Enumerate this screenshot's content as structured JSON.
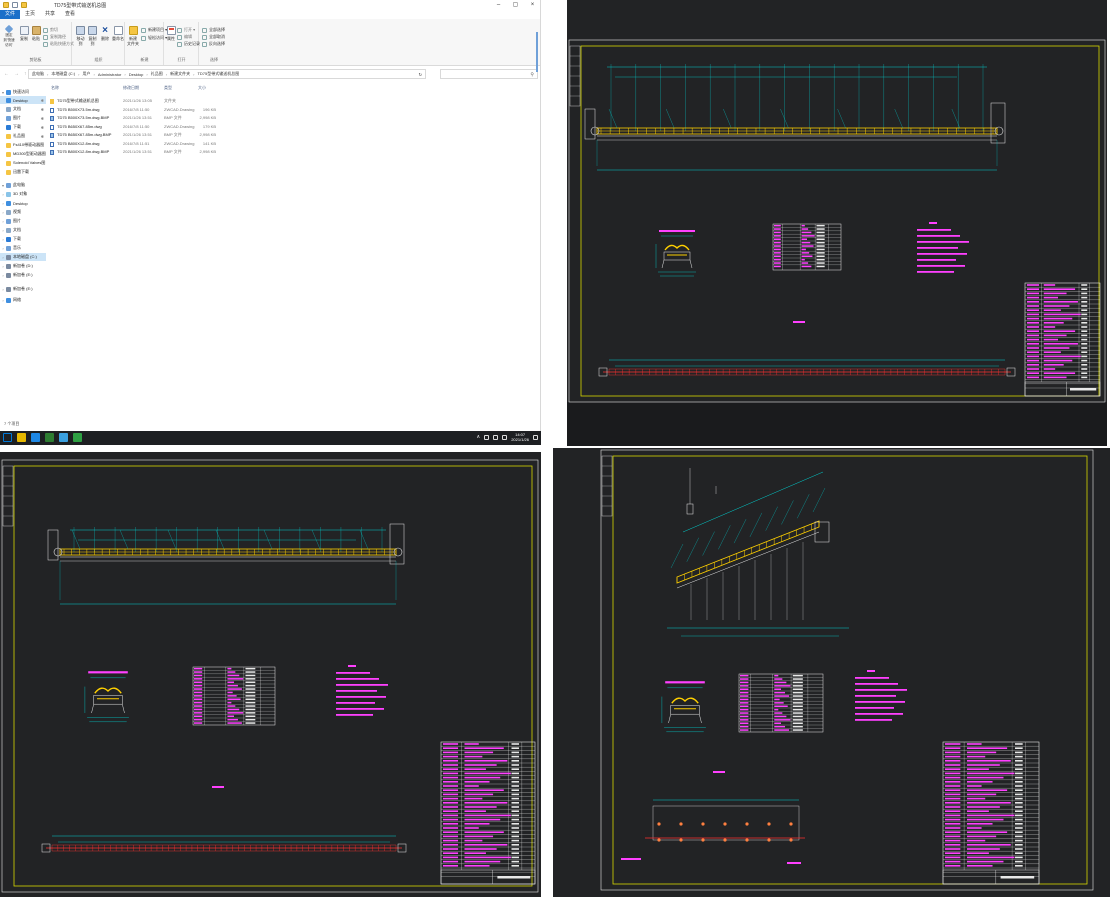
{
  "window": {
    "title": "TD75型带式输送机总图",
    "controls": {
      "minimize": "–",
      "maximize": "▢",
      "close": "×"
    }
  },
  "ribbon": {
    "tabs": [
      "文件",
      "主页",
      "共享",
      "查看"
    ],
    "clipboard": {
      "pin": "固定到'快速访问'",
      "copy": "复制",
      "paste": "粘贴",
      "cut": "剪切",
      "copy_path": "复制路径",
      "paste_shortcut": "粘贴快捷方式",
      "label": "剪贴板"
    },
    "organize": {
      "move_to": "移动到",
      "copy_to": "复制到",
      "delete": "删除",
      "rename": "重命名",
      "label": "组织"
    },
    "new": {
      "new_folder": "新建\n文件夹",
      "new_item": "新建项目 ▾",
      "easy_access": "轻松访问 ▾",
      "label": "新建"
    },
    "open": {
      "properties": "属性",
      "open": "打开 ▾",
      "edit": "编辑",
      "history": "历史记录",
      "label": "打开"
    },
    "select": {
      "select_all": "全部选择",
      "select_none": "全部取消",
      "invert": "反向选择",
      "label": "选择"
    }
  },
  "address": {
    "back": "←",
    "forward": "→",
    "up": "↑",
    "path": [
      "此电脑",
      "本地磁盘 (C:)",
      "用户",
      "Administrator",
      "Desktop",
      "礼品图",
      "新建文件夹",
      "TD75型带式输送机总图"
    ],
    "refresh": "↻",
    "search_icon": "⚲"
  },
  "nav": [
    {
      "label": "快速访问",
      "chev": "▾",
      "icon": "#3f8fe0"
    },
    {
      "label": "Desktop",
      "chev": "",
      "icon": "#3f8fe0",
      "selected": true,
      "pin": "✱"
    },
    {
      "label": "文档",
      "chev": "",
      "icon": "#8aa8c8",
      "pin": "✱"
    },
    {
      "label": "图片",
      "chev": "",
      "icon": "#6fa0d8",
      "pin": "✱"
    },
    {
      "label": "下载",
      "chev": "",
      "icon": "#2a7bd6",
      "pin": "✱"
    },
    {
      "label": "礼品图",
      "chev": "",
      "icon": "#f5c542",
      "pin": "✱"
    },
    {
      "label": "Fs410带驱动器图",
      "chev": "",
      "icon": "#f5c542"
    },
    {
      "label": "MD300型驱动器图",
      "chev": "",
      "icon": "#f5c542"
    },
    {
      "label": "Solenoid Valves图",
      "chev": "",
      "icon": "#f5c542"
    },
    {
      "label": "迅雷下载",
      "chev": "",
      "icon": "#f5c542"
    },
    {
      "label": "此电脑",
      "chev": "▾",
      "icon": "#6fa0d8"
    },
    {
      "label": "3D 对象",
      "chev": "›",
      "icon": "#8ac4e8"
    },
    {
      "label": "Desktop",
      "chev": "›",
      "icon": "#3f8fe0"
    },
    {
      "label": "视频",
      "chev": "›",
      "icon": "#8aa8c8"
    },
    {
      "label": "图片",
      "chev": "›",
      "icon": "#6fa0d8"
    },
    {
      "label": "文档",
      "chev": "›",
      "icon": "#8aa8c8"
    },
    {
      "label": "下载",
      "chev": "›",
      "icon": "#2a7bd6"
    },
    {
      "label": "音乐",
      "chev": "›",
      "icon": "#6fa0d8"
    },
    {
      "label": "本地磁盘 (C:)",
      "chev": "›",
      "icon": "#7a8aa0",
      "selected": true
    },
    {
      "label": "新加卷 (D:)",
      "chev": "›",
      "icon": "#7a8aa0"
    },
    {
      "label": "新加卷 (E:)",
      "chev": "›",
      "icon": "#7a8aa0"
    },
    {
      "label": "新加卷 (E:)",
      "chev": "›",
      "icon": "#7a8aa0"
    },
    {
      "label": "网络",
      "chev": "›",
      "icon": "#3f8fe0"
    }
  ],
  "file_columns": [
    "名称",
    "修改日期",
    "类型",
    "大小"
  ],
  "files": [
    {
      "icon": "folder",
      "name": "TD75型带式输送机总图",
      "date": "2021/1/26 13:05",
      "type": "文件夹",
      "size": ""
    },
    {
      "icon": "dwg",
      "name": "TD75 B500X73.5m.dwg",
      "date": "2016/7/8 11:50",
      "type": "ZWCAD.Drawing",
      "size": "196 KB"
    },
    {
      "icon": "bmp",
      "name": "TD75 B500X73.5m.dwg.BMP",
      "date": "2021/1/26 13:51",
      "type": "BMP 文件",
      "size": "2,998 KB"
    },
    {
      "icon": "dwg",
      "name": "TD75 B650X67.85m.dwg",
      "date": "2016/7/8 11:50",
      "type": "ZWCAD.Drawing",
      "size": "179 KB"
    },
    {
      "icon": "bmp",
      "name": "TD75 B650X67.85m.dwg.BMP",
      "date": "2021/1/26 13:51",
      "type": "BMP 文件",
      "size": "2,998 KB"
    },
    {
      "icon": "dwg",
      "name": "TD75 B800X12.8m.dwg",
      "date": "2016/7/8 11:51",
      "type": "ZWCAD.Drawing",
      "size": "141 KB"
    },
    {
      "icon": "bmp",
      "name": "TD75 B800X12.8m.dwg.BMP",
      "date": "2021/1/26 13:51",
      "type": "BMP 文件",
      "size": "2,998 KB"
    }
  ],
  "status": {
    "count": "7 个项目"
  },
  "taskbar": {
    "up_arrow": "∧",
    "time": "14:07",
    "date": "2021/1/26",
    "icons": [
      "#0078d7",
      "#e6b800",
      "#1e88e5",
      "#2e7d32",
      "#3aa0e0",
      "#2ea043"
    ]
  },
  "cad": {
    "colors": {
      "frame": "#d8d800",
      "dim": "#00d0d0",
      "text": "#ff40ff",
      "belt": "#ffd000",
      "center": "#ff3030",
      "white": "#e8e8e8"
    },
    "panels": [
      {
        "id": "top-right",
        "title": "",
        "notes_title": "",
        "section_title": ""
      },
      {
        "id": "bottom-left",
        "title": "",
        "notes_title": "",
        "section_title": ""
      },
      {
        "id": "bottom-right",
        "title": "",
        "notes_title": "",
        "section_title": ""
      }
    ]
  }
}
